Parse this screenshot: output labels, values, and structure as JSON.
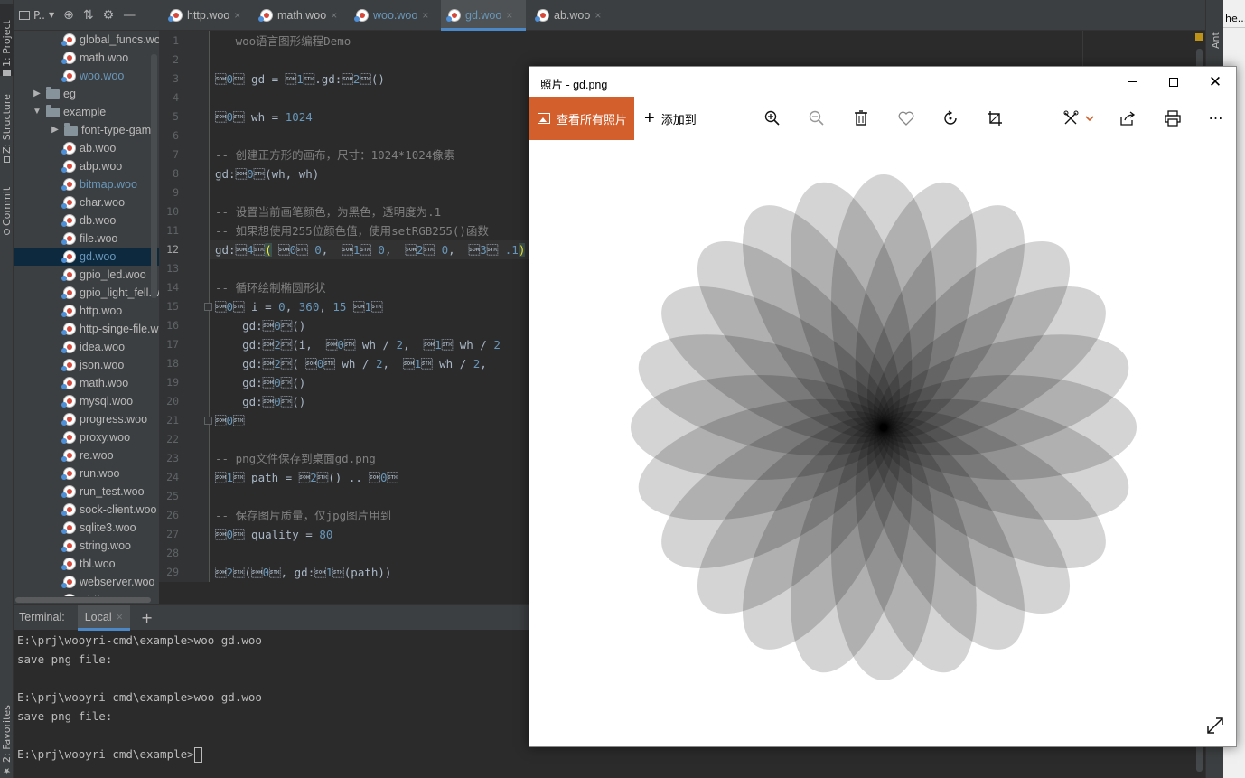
{
  "left_strip": {
    "project_tab": "1: Project",
    "structure_tab": "Z: Structure",
    "commit_tab": "Commit",
    "favorites_tab": "2: Favorites"
  },
  "right_strip": {
    "ant_tab": "Ant"
  },
  "project": {
    "selector_label": "P..",
    "tree": [
      {
        "label": "global_funcs.woo",
        "type": "file",
        "depth": 2,
        "color": "normal"
      },
      {
        "label": "math.woo",
        "type": "file",
        "depth": 2,
        "color": "normal"
      },
      {
        "label": "woo.woo",
        "type": "file",
        "depth": 2,
        "color": "blue"
      },
      {
        "label": "eg",
        "type": "folder",
        "depth": 1,
        "expanded": false
      },
      {
        "label": "example",
        "type": "folder",
        "depth": 1,
        "expanded": true
      },
      {
        "label": "font-type-game",
        "type": "folder",
        "depth": 2,
        "expanded": false
      },
      {
        "label": "ab.woo",
        "type": "file",
        "depth": 2,
        "color": "normal"
      },
      {
        "label": "abp.woo",
        "type": "file",
        "depth": 2,
        "color": "normal"
      },
      {
        "label": "bitmap.woo",
        "type": "file",
        "depth": 2,
        "color": "blue"
      },
      {
        "label": "char.woo",
        "type": "file",
        "depth": 2,
        "color": "normal"
      },
      {
        "label": "db.woo",
        "type": "file",
        "depth": 2,
        "color": "normal"
      },
      {
        "label": "file.woo",
        "type": "file",
        "depth": 2,
        "color": "normal"
      },
      {
        "label": "gd.woo",
        "type": "file",
        "depth": 2,
        "color": "blue",
        "selected": true
      },
      {
        "label": "gpio_led.woo",
        "type": "file",
        "depth": 2,
        "color": "normal"
      },
      {
        "label": "gpio_light_fell.woo",
        "type": "file",
        "depth": 2,
        "color": "normal"
      },
      {
        "label": "http.woo",
        "type": "file",
        "depth": 2,
        "color": "normal"
      },
      {
        "label": "http-singe-file.woo",
        "type": "file",
        "depth": 2,
        "color": "normal"
      },
      {
        "label": "idea.woo",
        "type": "file",
        "depth": 2,
        "color": "normal"
      },
      {
        "label": "json.woo",
        "type": "file",
        "depth": 2,
        "color": "normal"
      },
      {
        "label": "math.woo",
        "type": "file",
        "depth": 2,
        "color": "normal"
      },
      {
        "label": "mysql.woo",
        "type": "file",
        "depth": 2,
        "color": "normal"
      },
      {
        "label": "progress.woo",
        "type": "file",
        "depth": 2,
        "color": "normal"
      },
      {
        "label": "proxy.woo",
        "type": "file",
        "depth": 2,
        "color": "normal"
      },
      {
        "label": "re.woo",
        "type": "file",
        "depth": 2,
        "color": "normal"
      },
      {
        "label": "run.woo",
        "type": "file",
        "depth": 2,
        "color": "normal"
      },
      {
        "label": "run_test.woo",
        "type": "file",
        "depth": 2,
        "color": "normal"
      },
      {
        "label": "sock-client.woo",
        "type": "file",
        "depth": 2,
        "color": "normal"
      },
      {
        "label": "sqlite3.woo",
        "type": "file",
        "depth": 2,
        "color": "normal"
      },
      {
        "label": "string.woo",
        "type": "file",
        "depth": 2,
        "color": "normal"
      },
      {
        "label": "tbl.woo",
        "type": "file",
        "depth": 2,
        "color": "normal"
      },
      {
        "label": "webserver.woo",
        "type": "file",
        "depth": 2,
        "color": "normal"
      },
      {
        "label": "whttp.woo",
        "type": "file",
        "depth": 2,
        "color": "normal"
      }
    ]
  },
  "editor": {
    "tabs": [
      {
        "label": "http.woo",
        "active": false,
        "blue": false
      },
      {
        "label": "math.woo",
        "active": false,
        "blue": false
      },
      {
        "label": "woo.woo",
        "active": false,
        "blue": true
      },
      {
        "label": "gd.woo",
        "active": true,
        "blue": true
      },
      {
        "label": "ab.woo",
        "active": false,
        "blue": false
      }
    ],
    "current_line": 12,
    "lines": [
      "-- woo语言图形编程Demo",
      "",
      "local gd = woo.gd:new()",
      "",
      "local wh = 1024",
      "",
      "-- 创建正方形的画布，尺寸：1024*1024像素",
      "gd:create(wh, wh)",
      "",
      "-- 设置当前画笔颜色，为黑色，透明度为.1",
      "-- 如果想使用255位颜色值，使用setRGB255()函数",
      "gd:setRGBA( r: 0,  g: 0,  b: 0,  a: .1)",
      "",
      "-- 循环绘制椭圆形状",
      "for i = 0, 360, 15 do",
      "    gd:push()",
      "    gd:rotateAbout(i,  x: wh / 2,  y: wh / 2",
      "    gd:drawEllipse( x: wh / 2,  y: wh / 2,",
      "    gd:fill()",
      "    gd:pop()",
      "end",
      "",
      "-- png文件保存到桌面gd.png",
      "local path = _home() .. '/Desktop/gd.png'",
      "",
      "-- 保存图片质量，仅jpg图片用到",
      "local quality = 80",
      "",
      "print('save png file:', gd:savePng(path))"
    ]
  },
  "terminal": {
    "title": "Terminal:",
    "tab_label": "Local",
    "lines": [
      "E:\\prj\\wooyri-cmd\\example>woo gd.woo",
      "save png file:",
      "",
      "E:\\prj\\wooyri-cmd\\example>woo gd.woo",
      "save png file:",
      "",
      "E:\\prj\\wooyri-cmd\\example>"
    ]
  },
  "photos": {
    "title": "照片 - gd.png",
    "see_all_label": "查看所有照片",
    "add_to_label": "添加到",
    "accent_color": "#d35f2c",
    "image": {
      "ellipse_count": 24,
      "rotation_step_deg": 15,
      "fill": "#000000",
      "alpha": 0.1
    }
  },
  "far_right": {
    "fragment": "he..."
  }
}
